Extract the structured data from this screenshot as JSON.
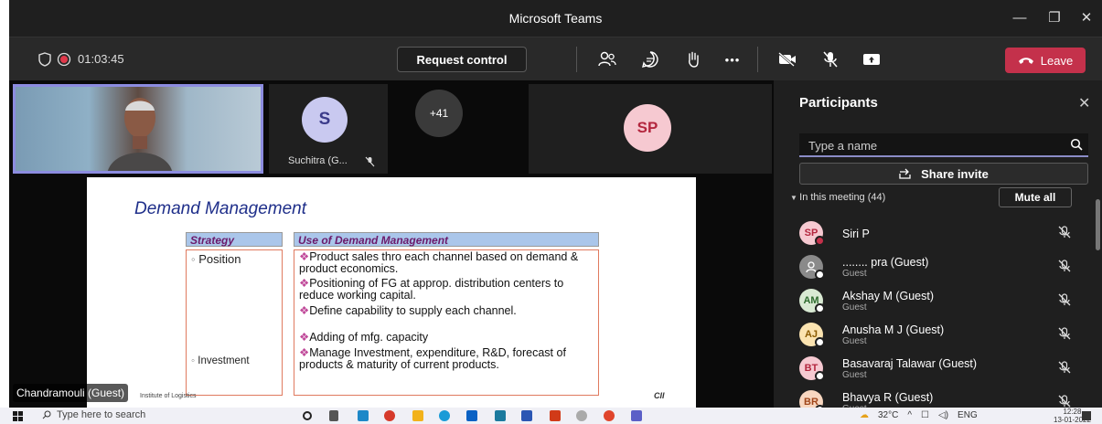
{
  "window": {
    "title": "Microsoft Teams",
    "controls": [
      "—",
      "❐",
      "✕"
    ]
  },
  "toolbar": {
    "timer": "01:03:45",
    "request_control": "Request control",
    "more": "•••",
    "leave": "Leave"
  },
  "stage": {
    "gallery": [
      {
        "initials": "S",
        "name": "Suchitra (G..."
      },
      {
        "initials": "+41"
      },
      {
        "initials": "SP"
      }
    ],
    "presenter_name": "Chandramouli (Guest)",
    "slide": {
      "title": "Demand Management",
      "col1_header": "Strategy",
      "col2_header": "Use of Demand Management",
      "strategies": [
        "Position",
        "Investment"
      ],
      "bullets": [
        "Product sales thro each channel based on demand & product economics.",
        "Positioning of FG at approp. distribution centers to reduce  working capital.",
        "Define capability to supply each channel.",
        "Adding of mfg. capacity",
        "Manage Investment, expenditure, R&D, forecast of products & maturity of current products."
      ],
      "logo_left": "Institute of Logistics",
      "logo_right": "CII"
    }
  },
  "panel": {
    "title": "Participants",
    "search_placeholder": "Type a name",
    "share_invite": "Share invite",
    "in_meeting": "In this meeting (44)",
    "mute_all": "Mute all",
    "participants": [
      {
        "initials": "SP",
        "name": "Siri P",
        "sub": "",
        "color": "#f6c9d1",
        "text": "#b3263e",
        "status": "#c4314b"
      },
      {
        "initials": "",
        "name": "........ pra (Guest)",
        "sub": "Guest",
        "color": "#8a8a8a",
        "text": "#fff",
        "status": "#fff"
      },
      {
        "initials": "AM",
        "name": "Akshay M (Guest)",
        "sub": "Guest",
        "color": "#d9ead3",
        "text": "#2e6b2e",
        "status": "#fff"
      },
      {
        "initials": "AJ",
        "name": "Anusha M J (Guest)",
        "sub": "Guest",
        "color": "#fbe3b0",
        "text": "#8a5a00",
        "status": "#fff"
      },
      {
        "initials": "BT",
        "name": "Basavaraj Talawar (Guest)",
        "sub": "Guest",
        "color": "#f6c9d1",
        "text": "#b3263e",
        "status": "#fff"
      },
      {
        "initials": "BR",
        "name": "Bhavya R (Guest)",
        "sub": "Guest",
        "color": "#f8d7c0",
        "text": "#a0461a",
        "status": "#fff"
      }
    ]
  },
  "taskbar": {
    "search_placeholder": "Type here to search",
    "weather": "32°C",
    "lang": "ENG",
    "time": "12:28",
    "date": "13-01-2022"
  }
}
